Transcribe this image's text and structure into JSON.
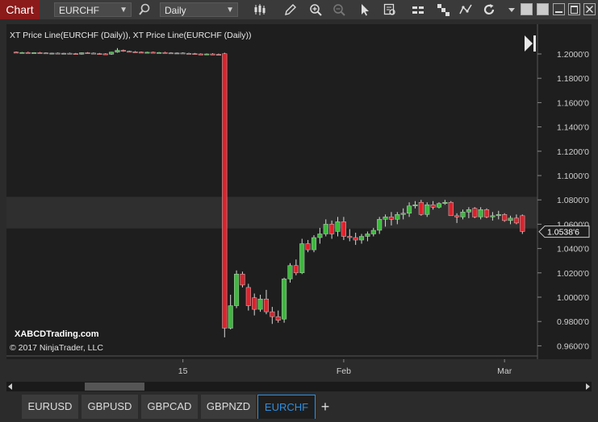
{
  "toolbar": {
    "title": "Chart",
    "instrument": "EURCHF",
    "interval": "Daily"
  },
  "chart": {
    "indicator_label": "XT Price Line(EURCHF (Daily)), XT Price Line(EURCHF (Daily))",
    "watermark_site": "XABCDTrading.com",
    "watermark_copyright": "© 2017 NinjaTrader, LLC",
    "current_price_label": "1.0538'6"
  },
  "tabs": [
    {
      "label": "EURUSD"
    },
    {
      "label": "GBPUSD"
    },
    {
      "label": "GBPCAD"
    },
    {
      "label": "GBPNZD"
    },
    {
      "label": "EURCHF"
    }
  ],
  "colors": {
    "up": "#3cb93c",
    "down": "#e0202a",
    "background": "#1e1e1e",
    "accent": "#2f8fe0",
    "title_bar": "#8b1a1a"
  },
  "chart_data": {
    "type": "candlestick",
    "ylim": [
      0.95,
      1.21
    ],
    "y_ticks": [
      {
        "value": 1.2,
        "label": "1.2000'0"
      },
      {
        "value": 1.18,
        "label": "1.1800'0"
      },
      {
        "value": 1.16,
        "label": "1.1600'0"
      },
      {
        "value": 1.14,
        "label": "1.1400'0"
      },
      {
        "value": 1.12,
        "label": "1.1200'0"
      },
      {
        "value": 1.1,
        "label": "1.1000'0"
      },
      {
        "value": 1.08,
        "label": "1.0800'0"
      },
      {
        "value": 1.06,
        "label": "1.0600'0"
      },
      {
        "value": 1.04,
        "label": "1.0400'0"
      },
      {
        "value": 1.02,
        "label": "1.0200'0"
      },
      {
        "value": 1.0,
        "label": "1.0000'0"
      },
      {
        "value": 0.98,
        "label": "0.9800'0"
      },
      {
        "value": 0.96,
        "label": "0.9600'0"
      }
    ],
    "x_ticks": [
      {
        "index": 28,
        "label": "15"
      },
      {
        "index": 55,
        "label": "Feb"
      },
      {
        "index": 82,
        "label": "Mar"
      }
    ],
    "current_price": 1.05386,
    "highlight_band": [
      1.0565,
      1.0825
    ],
    "candles": [
      [
        1.2015,
        1.202,
        1.2008,
        1.201
      ],
      [
        1.201,
        1.2016,
        1.2005,
        1.2012
      ],
      [
        1.2012,
        1.2018,
        1.2006,
        1.2008
      ],
      [
        1.2008,
        1.2014,
        1.2004,
        1.2011
      ],
      [
        1.2011,
        1.2016,
        1.2006,
        1.2009
      ],
      [
        1.2009,
        1.2013,
        1.2,
        1.2003
      ],
      [
        1.2003,
        1.201,
        1.1998,
        1.2007
      ],
      [
        1.2007,
        1.2012,
        1.2002,
        1.2004
      ],
      [
        1.2004,
        1.2009,
        1.1999,
        1.2006
      ],
      [
        1.2006,
        1.2011,
        1.2001,
        1.2003
      ],
      [
        1.2003,
        1.2008,
        1.1996,
        1.2
      ],
      [
        1.1998,
        1.2012,
        1.1995,
        1.201
      ],
      [
        1.201,
        1.2015,
        1.2004,
        1.2007
      ],
      [
        1.2007,
        1.2012,
        1.2001,
        1.2003
      ],
      [
        1.2003,
        1.2008,
        1.1998,
        1.2001
      ],
      [
        1.2001,
        1.2006,
        1.1994,
        1.1997
      ],
      [
        1.1998,
        1.2018,
        1.1993,
        1.2015
      ],
      [
        1.2015,
        1.2048,
        1.201,
        1.203
      ],
      [
        1.203,
        1.2036,
        1.2018,
        1.2022
      ],
      [
        1.2022,
        1.2027,
        1.2014,
        1.2018
      ],
      [
        1.2018,
        1.2024,
        1.201,
        1.2015
      ],
      [
        1.2015,
        1.202,
        1.2008,
        1.2012
      ],
      [
        1.2012,
        1.2018,
        1.2006,
        1.2014
      ],
      [
        1.2014,
        1.2019,
        1.2008,
        1.201
      ],
      [
        1.201,
        1.2016,
        1.2004,
        1.2012
      ],
      [
        1.2012,
        1.2017,
        1.2006,
        1.2009
      ],
      [
        1.2009,
        1.2014,
        1.2003,
        1.2006
      ],
      [
        1.2006,
        1.2012,
        1.2,
        1.2008
      ],
      [
        1.2008,
        1.2013,
        1.2002,
        1.2005
      ],
      [
        1.2005,
        1.201,
        1.1999,
        1.2003
      ],
      [
        1.2003,
        1.2008,
        1.1997,
        1.2
      ],
      [
        1.2,
        1.2005,
        1.1994,
        1.1998
      ],
      [
        1.1998,
        1.2004,
        1.1992,
        1.2
      ],
      [
        1.2,
        1.2006,
        1.1994,
        1.1997
      ],
      [
        1.1997,
        1.2003,
        1.199,
        1.1995
      ],
      [
        1.2002,
        1.201,
        0.967,
        0.9745
      ],
      [
        0.9745,
        1.002,
        0.9735,
        0.993
      ],
      [
        0.993,
        1.022,
        0.991,
        1.019
      ],
      [
        1.019,
        1.021,
        1.008,
        1.01
      ],
      [
        1.008,
        1.011,
        0.989,
        0.993
      ],
      [
        0.9995,
        1.003,
        0.985,
        0.99
      ],
      [
        0.99,
        1.002,
        0.988,
        0.9985
      ],
      [
        0.9985,
        1.006,
        0.986,
        0.988
      ],
      [
        0.988,
        0.992,
        0.978,
        0.984
      ],
      [
        0.984,
        0.989,
        0.979,
        0.981
      ],
      [
        0.982,
        1.016,
        0.979,
        1.015
      ],
      [
        1.015,
        1.028,
        1.012,
        1.026
      ],
      [
        1.026,
        1.031,
        1.018,
        1.02
      ],
      [
        1.02,
        1.048,
        1.019,
        1.044
      ],
      [
        1.044,
        1.047,
        1.037,
        1.039
      ],
      [
        1.039,
        1.051,
        1.037,
        1.049
      ],
      [
        1.049,
        1.057,
        1.044,
        1.052
      ],
      [
        1.052,
        1.064,
        1.05,
        1.06
      ],
      [
        1.06,
        1.063,
        1.048,
        1.052
      ],
      [
        1.054,
        1.066,
        1.05,
        1.062
      ],
      [
        1.062,
        1.066,
        1.047,
        1.05
      ],
      [
        1.05,
        1.056,
        1.046,
        1.049
      ],
      [
        1.049,
        1.053,
        1.043,
        1.047
      ],
      [
        1.047,
        1.052,
        1.044,
        1.05
      ],
      [
        1.05,
        1.054,
        1.046,
        1.052
      ],
      [
        1.052,
        1.057,
        1.05,
        1.055
      ],
      [
        1.055,
        1.066,
        1.052,
        1.064
      ],
      [
        1.064,
        1.068,
        1.058,
        1.066
      ],
      [
        1.066,
        1.07,
        1.059,
        1.064
      ],
      [
        1.064,
        1.07,
        1.06,
        1.068
      ],
      [
        1.068,
        1.073,
        1.064,
        1.069
      ],
      [
        1.069,
        1.078,
        1.066,
        1.075
      ],
      [
        1.075,
        1.079,
        1.073,
        1.076
      ],
      [
        1.078,
        1.08,
        1.067,
        1.068
      ],
      [
        1.068,
        1.078,
        1.066,
        1.076
      ],
      [
        1.076,
        1.079,
        1.072,
        1.074
      ],
      [
        1.074,
        1.078,
        1.073,
        1.077
      ],
      [
        1.077,
        1.08,
        1.076,
        1.078
      ],
      [
        1.078,
        1.079,
        1.067,
        1.067
      ],
      [
        1.067,
        1.069,
        1.061,
        1.066
      ],
      [
        1.066,
        1.072,
        1.064,
        1.07
      ],
      [
        1.07,
        1.074,
        1.065,
        1.072
      ],
      [
        1.073,
        1.074,
        1.065,
        1.066
      ],
      [
        1.066,
        1.074,
        1.064,
        1.072
      ],
      [
        1.072,
        1.073,
        1.065,
        1.066
      ],
      [
        1.066,
        1.07,
        1.063,
        1.067
      ],
      [
        1.067,
        1.071,
        1.064,
        1.068
      ],
      [
        1.068,
        1.069,
        1.062,
        1.063
      ],
      [
        1.063,
        1.067,
        1.06,
        1.065
      ],
      [
        1.065,
        1.068,
        1.06,
        1.061
      ],
      [
        1.067,
        1.068,
        1.052,
        1.054
      ]
    ]
  }
}
